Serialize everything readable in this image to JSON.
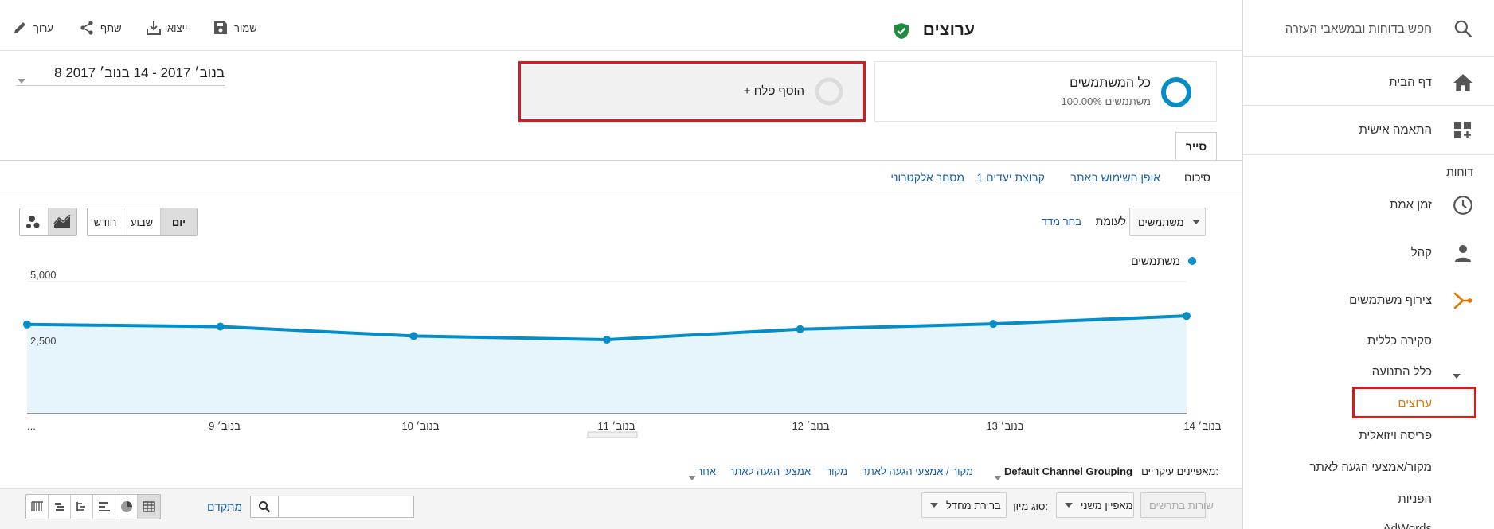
{
  "sidebar": {
    "search_placeholder": "חפש בדוחות ובמשאבי העזרה",
    "home": "דף הבית",
    "customization": "התאמה אישית",
    "reports_section": "דוחות",
    "realtime": "זמן אמת",
    "audience": "קהל",
    "acquisition": "צירוף משתמשים",
    "overview": "סקירה כללית",
    "all_traffic": "כלל התנועה",
    "channels": "ערוצים",
    "treemaps": "פריסה ויזואלית",
    "source_medium": "מקור/אמצעי הגעה לאתר",
    "referrals": "הפניות",
    "next_item": "AdWords",
    "accent_color": "#e37400"
  },
  "header": {
    "title": "ערוצים",
    "save": "שמור",
    "export": "ייצוא",
    "share": "שתף",
    "edit": "ערוך"
  },
  "segments": {
    "all_users_title": "כל המשתמשים",
    "all_users_sub": "100.00% משתמשים",
    "add_segment": "+ הוסף פלח"
  },
  "date_range": "8 בנוב׳ 2017 - 14 בנוב׳ 2017",
  "tabs": {
    "explorer": "סייר",
    "summary": "סיכום",
    "site_usage": "אופן השימוש באתר",
    "goal_set": "קבוצת יעדים 1",
    "ecommerce": "מסחר אלקטרוני"
  },
  "controls": {
    "metric": "משתמשים",
    "versus": "לעומת",
    "select_metric": "בחר מדד",
    "day": "יום",
    "week": "שבוע",
    "month": "חודש"
  },
  "chart_data": {
    "type": "area",
    "series": [
      {
        "name": "משתמשים",
        "values": [
          3700,
          3400,
          3200,
          2800,
          2940,
          3300,
          3380
        ]
      }
    ],
    "x": [
      "14 בנוב׳",
      "13 בנוב׳",
      "12 בנוב׳",
      "11 בנוב׳",
      "10 בנוב׳",
      "9 בנוב׳",
      "..."
    ],
    "y_ticks": [
      "5,000",
      "2,500"
    ],
    "ylim": [
      0,
      5000
    ],
    "color": "#058dc7",
    "fill": "#e6f4fb",
    "grid": true
  },
  "dimensions": {
    "label": "מאפיינים עיקריים:",
    "selected": "Default Channel Grouping",
    "options": [
      "מקור / אמצעי הגעה לאתר",
      "מקור",
      "אמצעי הגעה לאתר",
      "אחר"
    ]
  },
  "table_controls": {
    "plot_rows": "שורות בתרשים",
    "secondary_dimension": "מאפיין משני",
    "sort_type_label": "סוג מיון:",
    "sort_default": "ברירת מחדל",
    "advanced": "מתקדם"
  }
}
